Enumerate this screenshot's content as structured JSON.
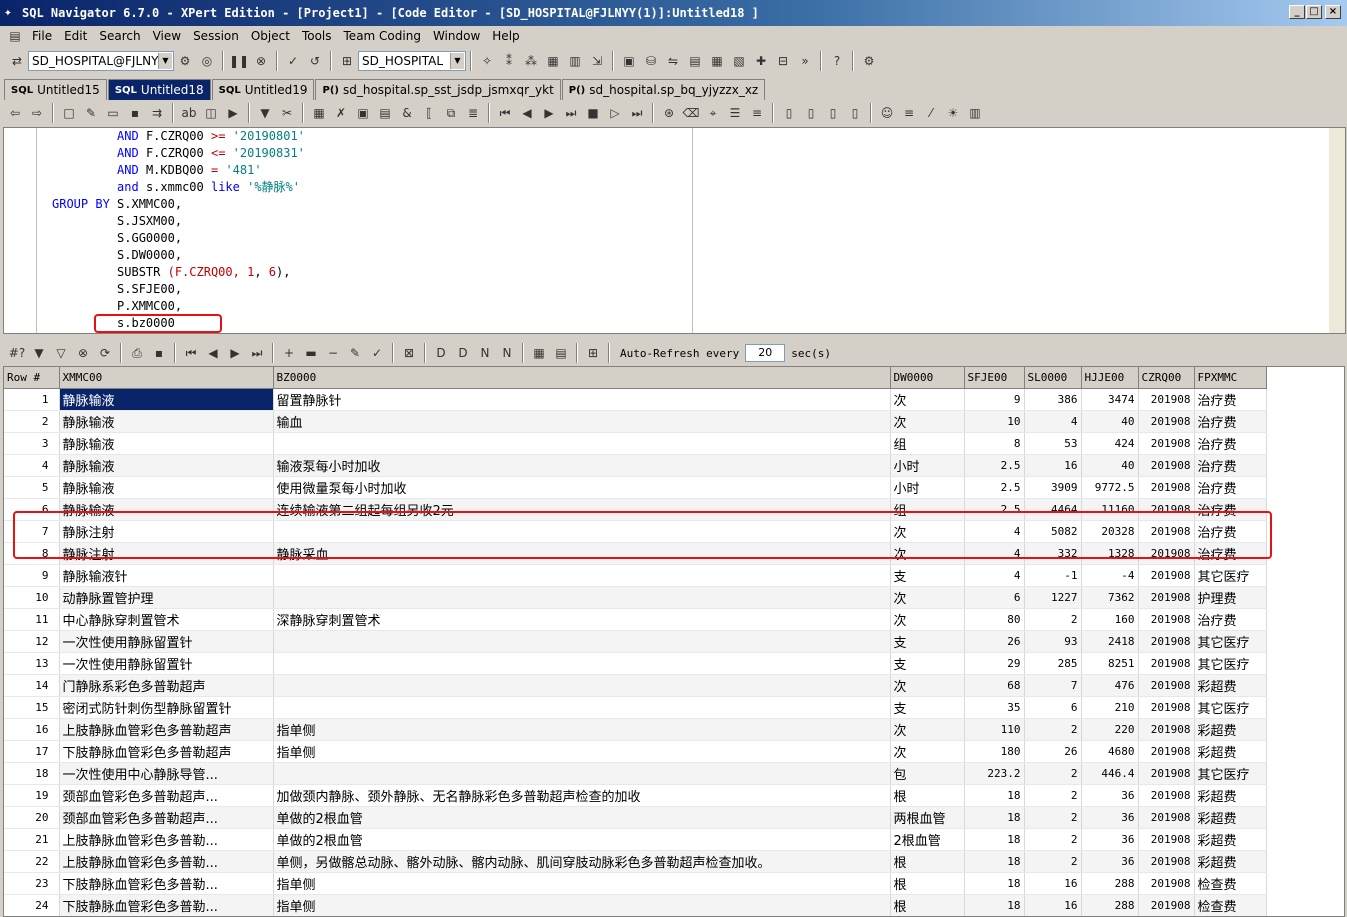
{
  "window": {
    "title": "SQL Navigator 6.7.0 - XPert Edition - [Project1] - [Code Editor - [SD_HOSPITAL@FJLNYY(1)]:Untitled18 ]"
  },
  "menu": [
    "File",
    "Edit",
    "Search",
    "View",
    "Session",
    "Object",
    "Tools",
    "Team Coding",
    "Window",
    "Help"
  ],
  "toolbar": {
    "connection": "SD_HOSPITAL@FJLNYY(",
    "schema": "SD_HOSPITAL"
  },
  "tabs": [
    {
      "icon": "SQL",
      "label": "Untitled15",
      "active": false
    },
    {
      "icon": "SQL",
      "label": "Untitled18",
      "active": true
    },
    {
      "icon": "SQL",
      "label": "Untitled19",
      "active": false
    },
    {
      "icon": "P()",
      "label": "sd_hospital.sp_sst_jsdp_jsmxqr_ykt",
      "active": false
    },
    {
      "icon": "P()",
      "label": "sd_hospital.sp_bq_yjyzzx_xz",
      "active": false
    }
  ],
  "code_lines": [
    [
      {
        "t": "         "
      },
      {
        "t": "AND",
        "c": "kw"
      },
      {
        "t": " F.CZRQ00 "
      },
      {
        "t": ">=",
        "c": "op"
      },
      {
        "t": " "
      },
      {
        "t": "'20190801'",
        "c": "str"
      }
    ],
    [
      {
        "t": "         "
      },
      {
        "t": "AND",
        "c": "kw"
      },
      {
        "t": " F.CZRQ00 "
      },
      {
        "t": "<=",
        "c": "op"
      },
      {
        "t": " "
      },
      {
        "t": "'20190831'",
        "c": "str"
      }
    ],
    [
      {
        "t": "         "
      },
      {
        "t": "AND",
        "c": "kw"
      },
      {
        "t": " M.KDBQ00 "
      },
      {
        "t": "=",
        "c": "op"
      },
      {
        "t": " "
      },
      {
        "t": "'481'",
        "c": "str"
      }
    ],
    [
      {
        "t": "         "
      },
      {
        "t": "and",
        "c": "kw"
      },
      {
        "t": " s.xmmc00 "
      },
      {
        "t": "like",
        "c": "kw"
      },
      {
        "t": " "
      },
      {
        "t": "'%静脉%'",
        "c": "str"
      }
    ],
    [
      {
        "t": "GROUP BY",
        "c": "kw"
      },
      {
        "t": " S.XMMC00,"
      }
    ],
    [
      {
        "t": "         S.JSXM00,"
      }
    ],
    [
      {
        "t": "         S.GG0000,"
      }
    ],
    [
      {
        "t": "         S.DW0000,"
      }
    ],
    [
      {
        "t": "         SUBSTR "
      },
      {
        "t": "(F.CZRQ00, ",
        "c": "op"
      },
      {
        "t": "1",
        "c": "op"
      },
      {
        "t": ", "
      },
      {
        "t": "6",
        "c": "op"
      },
      {
        "t": "),"
      }
    ],
    [
      {
        "t": "         S.SFJE00,"
      }
    ],
    [
      {
        "t": "         P.XMMC00,"
      }
    ],
    [
      {
        "t": "         s.bz0000"
      }
    ]
  ],
  "grid_toolbar": {
    "auto_refresh_label": "Auto-Refresh every",
    "interval": "20",
    "unit": "sec(s)"
  },
  "columns": [
    "Row #",
    "XMMC00",
    "BZ0000",
    "DW0000",
    "SFJE00",
    "SL0000",
    "HJJE00",
    "CZRQ00",
    "FPXMMC"
  ],
  "rows": [
    [
      "1",
      "静脉输液",
      "留置静脉针",
      "次",
      "9",
      "386",
      "3474",
      "201908",
      "治疗费"
    ],
    [
      "2",
      "静脉输液",
      "输血",
      "次",
      "10",
      "4",
      "40",
      "201908",
      "治疗费"
    ],
    [
      "3",
      "静脉输液",
      "",
      "组",
      "8",
      "53",
      "424",
      "201908",
      "治疗费"
    ],
    [
      "4",
      "静脉输液",
      "输液泵每小时加收",
      "小时",
      "2.5",
      "16",
      "40",
      "201908",
      "治疗费"
    ],
    [
      "5",
      "静脉输液",
      "使用微量泵每小时加收",
      "小时",
      "2.5",
      "3909",
      "9772.5",
      "201908",
      "治疗费"
    ],
    [
      "6",
      "静脉输液",
      "连续输液第二组起每组另收2元",
      "组",
      "2.5",
      "4464",
      "11160",
      "201908",
      "治疗费"
    ],
    [
      "7",
      "静脉注射",
      "",
      "次",
      "4",
      "5082",
      "20328",
      "201908",
      "治疗费"
    ],
    [
      "8",
      "静脉注射",
      "静脉采血",
      "次",
      "4",
      "332",
      "1328",
      "201908",
      "治疗费"
    ],
    [
      "9",
      "静脉输液针",
      "",
      "支",
      "4",
      "-1",
      "-4",
      "201908",
      "其它医疗"
    ],
    [
      "10",
      "动静脉置管护理",
      "",
      "次",
      "6",
      "1227",
      "7362",
      "201908",
      "护理费"
    ],
    [
      "11",
      "中心静脉穿刺置管术",
      "深静脉穿刺置管术",
      "次",
      "80",
      "2",
      "160",
      "201908",
      "治疗费"
    ],
    [
      "12",
      "一次性使用静脉留置针",
      "",
      "支",
      "26",
      "93",
      "2418",
      "201908",
      "其它医疗"
    ],
    [
      "13",
      "一次性使用静脉留置针",
      "",
      "支",
      "29",
      "285",
      "8251",
      "201908",
      "其它医疗"
    ],
    [
      "14",
      "门静脉系彩色多普勒超声",
      "",
      "次",
      "68",
      "7",
      "476",
      "201908",
      "彩超费"
    ],
    [
      "15",
      "密闭式防针刺伤型静脉留置针",
      "",
      "支",
      "35",
      "6",
      "210",
      "201908",
      "其它医疗"
    ],
    [
      "16",
      "上肢静脉血管彩色多普勒超声",
      "指单侧",
      "次",
      "110",
      "2",
      "220",
      "201908",
      "彩超费"
    ],
    [
      "17",
      "下肢静脉血管彩色多普勒超声",
      "指单侧",
      "次",
      "180",
      "26",
      "4680",
      "201908",
      "彩超费"
    ],
    [
      "18",
      "一次性使用中心静脉导管...",
      "",
      "包",
      "223.2",
      "2",
      "446.4",
      "201908",
      "其它医疗"
    ],
    [
      "19",
      "颈部血管彩色多普勒超声...",
      "加做颈内静脉、颈外静脉、无名静脉彩色多普勒超声检查的加收",
      "根",
      "18",
      "2",
      "36",
      "201908",
      "彩超费"
    ],
    [
      "20",
      "颈部血管彩色多普勒超声...",
      "单做的2根血管",
      "两根血管",
      "18",
      "2",
      "36",
      "201908",
      "彩超费"
    ],
    [
      "21",
      "上肢静脉血管彩色多普勒...",
      "单做的2根血管",
      "2根血管",
      "18",
      "2",
      "36",
      "201908",
      "彩超费"
    ],
    [
      "22",
      "上肢静脉血管彩色多普勒...",
      "单侧，另做髂总动脉、髂外动脉、髂内动脉、肌间穿肢动脉彩色多普勒超声检查加收。",
      "根",
      "18",
      "2",
      "36",
      "201908",
      "彩超费"
    ],
    [
      "23",
      "下肢静脉血管彩色多普勒...",
      "指单侧",
      "根",
      "18",
      "16",
      "288",
      "201908",
      "检查费"
    ],
    [
      "24",
      "下肢静脉血管彩色多普勒...",
      "指单侧",
      "根",
      "18",
      "16",
      "288",
      "201908",
      "检查费"
    ]
  ]
}
